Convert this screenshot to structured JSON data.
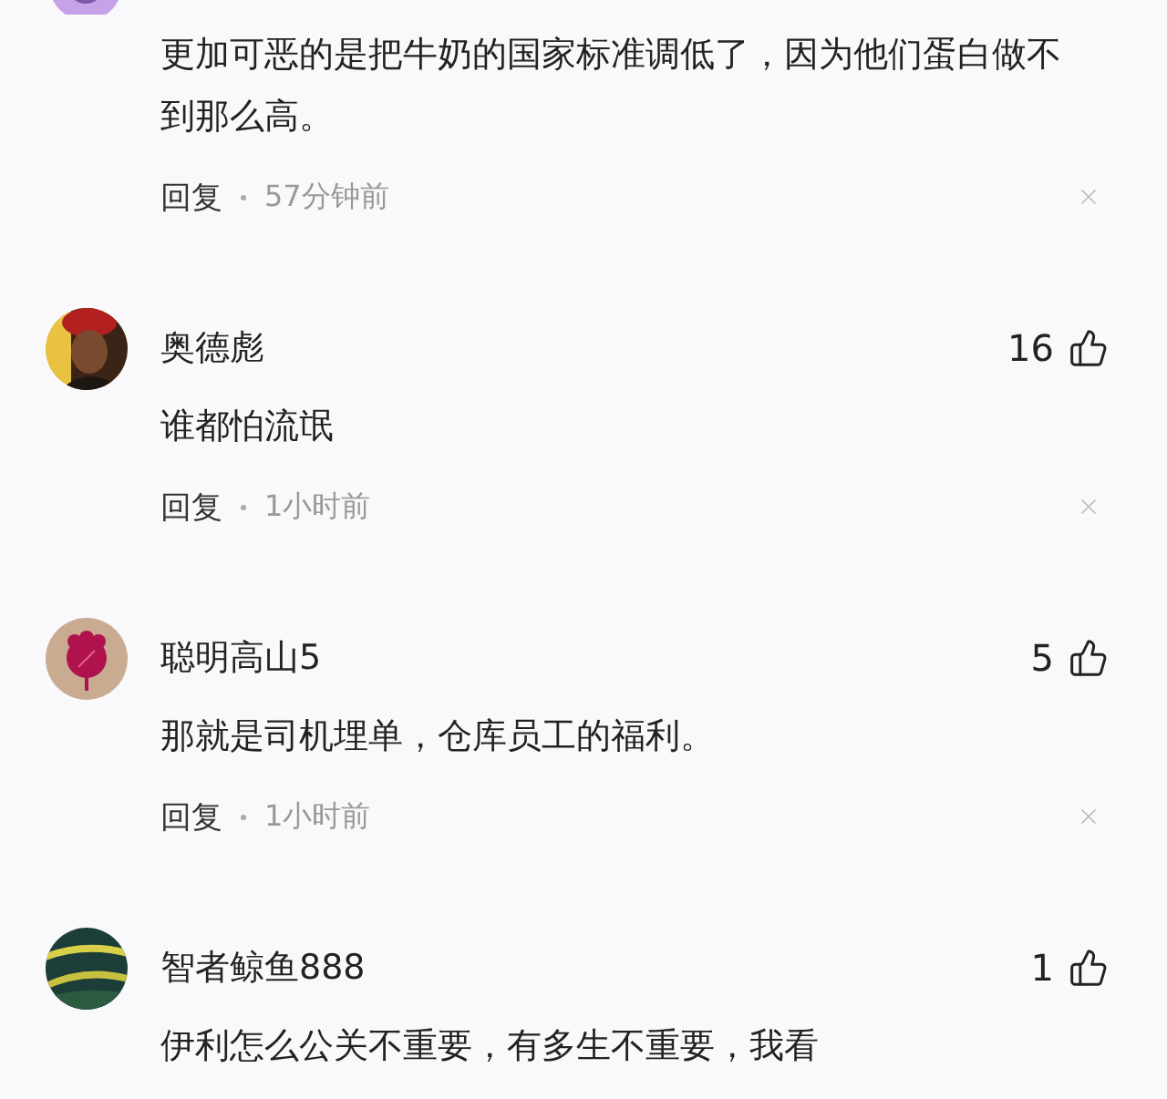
{
  "comments": [
    {
      "body": "更加可恶的是把牛奶的国家标准调低了，因为他们蛋白做不到那么高。",
      "reply": "回复",
      "time": "57分钟前"
    },
    {
      "name": "奥德彪",
      "likes": "16",
      "body": "谁都怕流氓",
      "reply": "回复",
      "time": "1小时前"
    },
    {
      "name": "聪明高山5",
      "likes": "5",
      "body": "那就是司机埋单，仓库员工的福利。",
      "reply": "回复",
      "time": "1小时前"
    },
    {
      "name": "智者鲸鱼888",
      "likes": "1",
      "body": "伊利怎么公关不重要，有多生不重要，我看"
    }
  ]
}
